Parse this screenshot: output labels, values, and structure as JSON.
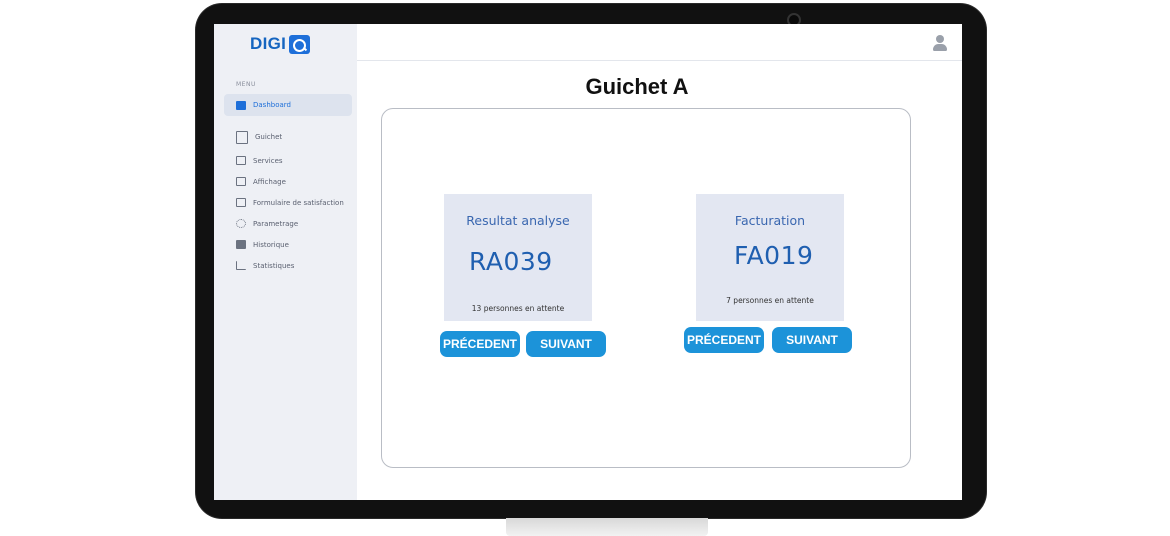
{
  "app": {
    "brand": "DIGI"
  },
  "sidebar": {
    "menu_caption": "MENU",
    "items": [
      {
        "label": "Dashboard",
        "icon": "dashboard-icon",
        "active": true
      },
      {
        "label": "Guichet",
        "icon": "guichet-icon"
      },
      {
        "label": "Services",
        "icon": "services-icon"
      },
      {
        "label": "Affichage",
        "icon": "display-icon"
      },
      {
        "label": "Formulaire de satisfaction",
        "icon": "form-icon"
      },
      {
        "label": "Parametrage",
        "icon": "gear-icon"
      },
      {
        "label": "Historique",
        "icon": "history-icon"
      },
      {
        "label": "Statistiques",
        "icon": "chart-icon"
      }
    ]
  },
  "header": {
    "user_icon": "user-icon"
  },
  "page": {
    "title": "Guichet A"
  },
  "tickets": [
    {
      "label": "Resultat analyse",
      "code": "RA039",
      "waiting": "13 personnes en attente",
      "prev_label": "PRÉCEDENT",
      "next_label": "SUIVANT"
    },
    {
      "label": "Facturation",
      "code": "FA019",
      "waiting": "7 personnes en attente",
      "prev_label": "PRÉCEDENT",
      "next_label": "SUIVANT"
    }
  ],
  "colors": {
    "accent": "#1c93d9",
    "brand": "#1565c0",
    "sidebar_bg": "#eef0f5",
    "ticket_bg": "#e3e7f2"
  }
}
